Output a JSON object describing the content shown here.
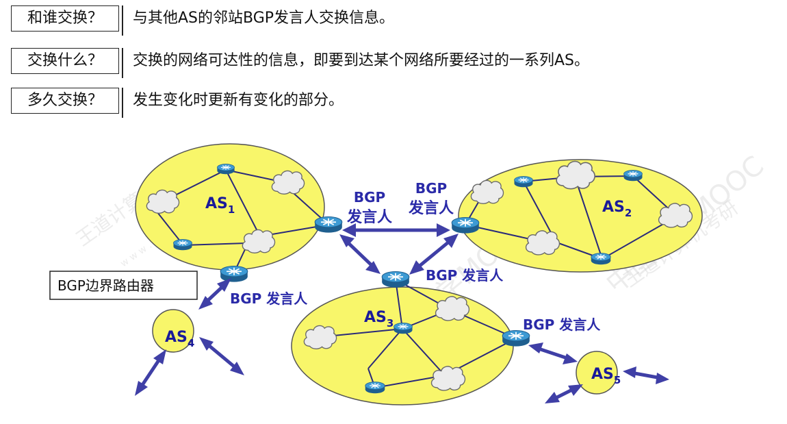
{
  "qa": [
    {
      "question": "和谁交换？",
      "answer": "与其他AS的邻站BGP发言人交换信息。"
    },
    {
      "question": "交换什么？",
      "answer": "交换的网络可达性的信息，即要到达某个网络所要经过的一系列AS。"
    },
    {
      "question": "多久交换？",
      "answer": "发生变化时更新有变化的部分。"
    }
  ],
  "diagram": {
    "as_base": "AS",
    "as_subscripts": [
      "1",
      "2",
      "3",
      "4",
      "5"
    ],
    "speaker_bgp": "BGP",
    "speaker_role": "发言人",
    "speaker_full": "BGP 发言人",
    "border_router_label": "BGP边界路由器"
  },
  "watermarks": {
    "brand_cn": "王道计算机考研",
    "site": "w w w . c s k a o y a n . c o m",
    "mooc": "中国大学MOOC"
  },
  "colors": {
    "as_fill": "#f8f66a",
    "arrow": "#3f3fa6",
    "label": "#2a2aa8",
    "router": "#2e86c1"
  }
}
